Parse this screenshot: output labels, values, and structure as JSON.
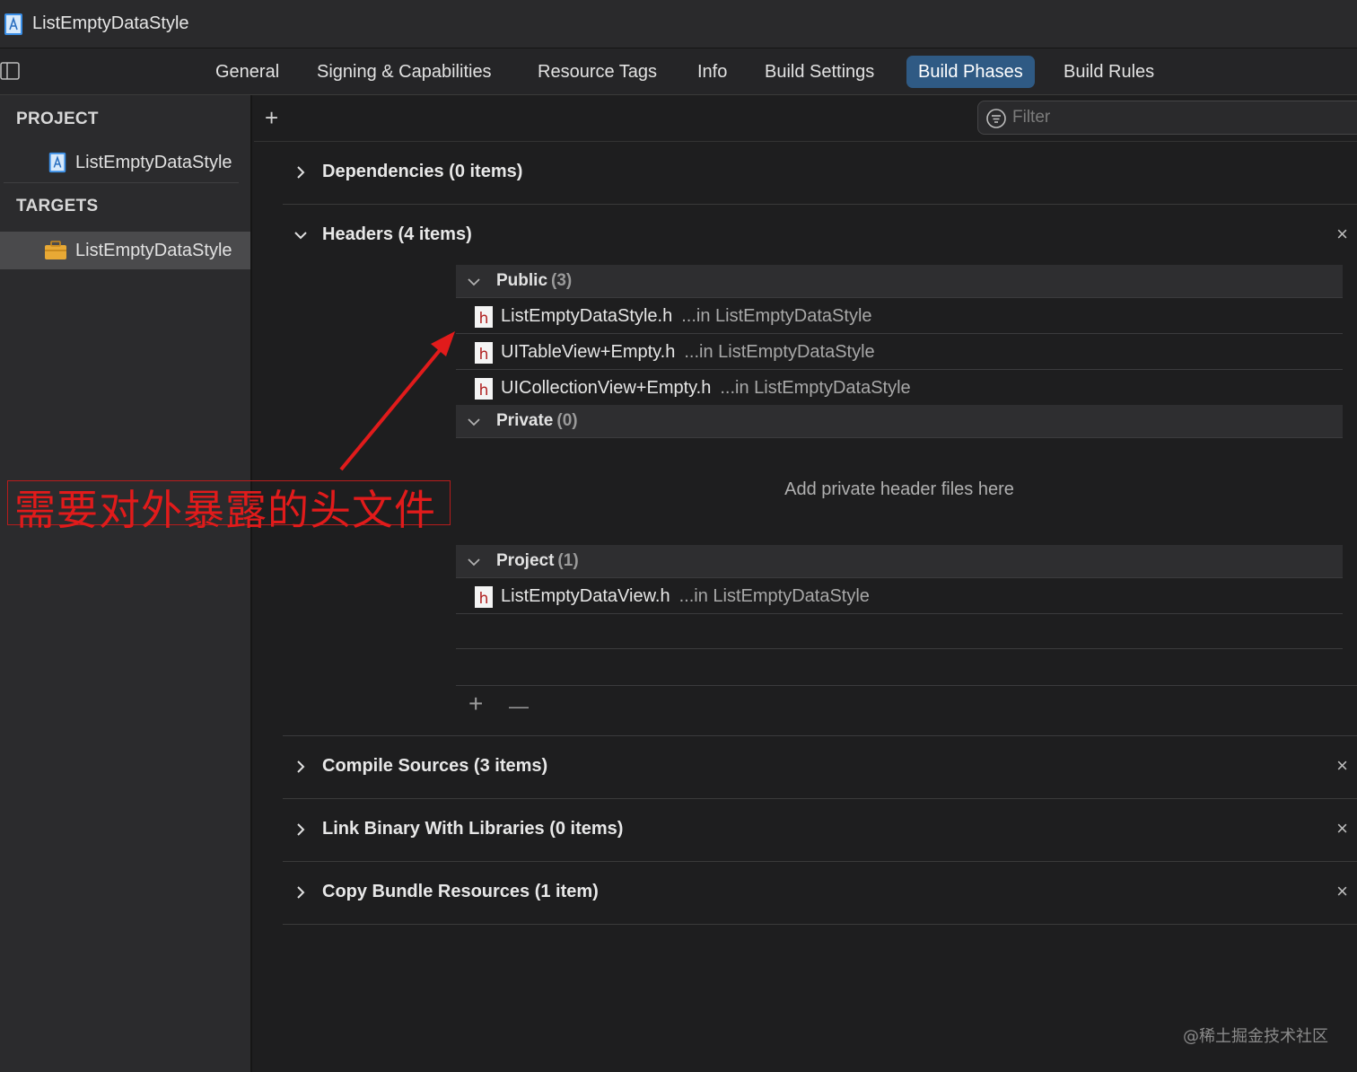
{
  "window": {
    "title": "ListEmptyDataStyle"
  },
  "tabs": [
    "General",
    "Signing & Capabilities",
    "Resource Tags",
    "Info",
    "Build Settings",
    "Build Phases",
    "Build Rules"
  ],
  "active_tab": "Build Phases",
  "navigator": {
    "project_header": "PROJECT",
    "project_item": "ListEmptyDataStyle",
    "targets_header": "TARGETS",
    "target_item": "ListEmptyDataStyle"
  },
  "toolbar": {
    "add_symbol": "+",
    "filter_placeholder": "Filter"
  },
  "phases": {
    "dependencies": "Dependencies (0 items)",
    "headers": "Headers (4 items)",
    "compile_sources": "Compile Sources (3 items)",
    "link_binary": "Link Binary With Libraries (0 items)",
    "copy_bundle": "Copy Bundle Resources (1 item)",
    "close_symbol": "×"
  },
  "headers": {
    "public": {
      "name": "Public",
      "count": "(3)"
    },
    "private": {
      "name": "Private",
      "count": "(0)"
    },
    "project": {
      "name": "Project",
      "count": "(1)"
    },
    "public_files": [
      {
        "name": "ListEmptyDataStyle.h",
        "location": "...in ListEmptyDataStyle"
      },
      {
        "name": "UITableView+Empty.h",
        "location": "...in ListEmptyDataStyle"
      },
      {
        "name": "UICollectionView+Empty.h",
        "location": "...in ListEmptyDataStyle"
      }
    ],
    "project_files": [
      {
        "name": "ListEmptyDataView.h",
        "location": "...in ListEmptyDataStyle"
      }
    ],
    "private_hint": "Add private header files here",
    "add_symbol": "+",
    "remove_symbol": "—"
  },
  "annotation": {
    "text": "需要对外暴露的头文件",
    "color": "#e11b1b"
  },
  "watermark": "@稀土掘金技术社区",
  "colors": {
    "background": "#1e1e1f",
    "accent": "#2f5a84",
    "annotation": "#e11b1b"
  }
}
